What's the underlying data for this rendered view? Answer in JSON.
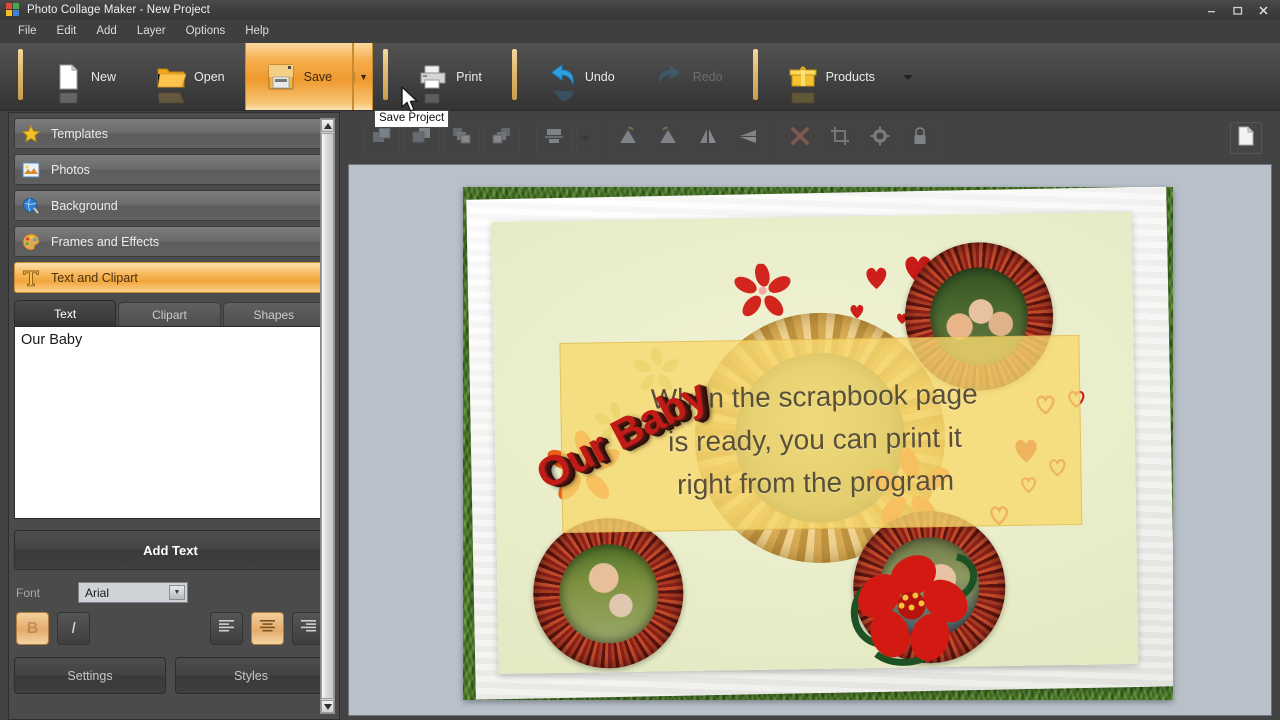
{
  "window": {
    "title": "Photo Collage Maker - New Project",
    "logo_icon": "app-logo-icon",
    "minimize_label": "–",
    "maximize_label": "❐",
    "close_label": "✕"
  },
  "menubar": {
    "items": [
      {
        "label": "File"
      },
      {
        "label": "Edit"
      },
      {
        "label": "Add"
      },
      {
        "label": "Layer"
      },
      {
        "label": "Options"
      },
      {
        "label": "Help"
      }
    ]
  },
  "toolbar": {
    "buttons": [
      {
        "label": "New",
        "icon": "new-document-icon",
        "state": "normal"
      },
      {
        "label": "Open",
        "icon": "open-folder-icon",
        "state": "normal"
      },
      {
        "label": "Save",
        "icon": "floppy-disk-icon",
        "state": "active"
      },
      {
        "label": "Print",
        "icon": "printer-icon",
        "state": "normal"
      },
      {
        "label": "Undo",
        "icon": "undo-arrow-icon",
        "state": "normal"
      },
      {
        "label": "Redo",
        "icon": "redo-arrow-icon",
        "state": "disabled"
      },
      {
        "label": "Products",
        "icon": "products-box-icon",
        "state": "normal"
      }
    ],
    "save_dropdown_icon": "chevron-down-icon",
    "products_dropdown_icon": "chevron-down-icon"
  },
  "tooltip": {
    "text": "Save Project"
  },
  "sidebar": {
    "items": [
      {
        "label": "Templates",
        "icon": "star-icon",
        "selected": false
      },
      {
        "label": "Photos",
        "icon": "photo-icon",
        "selected": false
      },
      {
        "label": "Background",
        "icon": "globe-brush-icon",
        "selected": false
      },
      {
        "label": "Frames and Effects",
        "icon": "palette-icon",
        "selected": false
      },
      {
        "label": "Text and Clipart",
        "icon": "text-t-icon",
        "selected": true
      }
    ],
    "scrollbar": {
      "up_icon": "scroll-up-arrow-icon",
      "down_icon": "scroll-down-arrow-icon"
    }
  },
  "text_panel": {
    "tabs": [
      {
        "label": "Text",
        "active": true
      },
      {
        "label": "Clipart",
        "active": false
      },
      {
        "label": "Shapes",
        "active": false
      }
    ],
    "textarea_value": "Our Baby",
    "textarea_placeholder": "",
    "add_text_label": "Add Text",
    "font_label": "Font",
    "font_value": "Arial",
    "font_options": [
      "Arial"
    ],
    "style_buttons": [
      {
        "name": "bold",
        "glyph": "B",
        "active": true
      },
      {
        "name": "italic",
        "glyph": "I",
        "active": false
      },
      {
        "name": "align-left",
        "glyph": "",
        "active": false
      },
      {
        "name": "align-center",
        "glyph": "",
        "active": true
      },
      {
        "name": "align-right",
        "glyph": "",
        "active": false
      }
    ],
    "settings_label": "Settings",
    "styles_label": "Styles"
  },
  "canvas_toolbar": {
    "buttons": [
      {
        "icon": "bring-forward-icon"
      },
      {
        "icon": "send-backward-icon"
      },
      {
        "icon": "bring-to-front-icon"
      },
      {
        "icon": "send-to-back-icon"
      },
      {
        "icon": "align-icon"
      },
      {
        "icon": "align-dropdown-icon"
      },
      {
        "icon": "rotate-left-icon"
      },
      {
        "icon": "rotate-right-icon"
      },
      {
        "icon": "flip-horizontal-icon"
      },
      {
        "icon": "flip-vertical-icon"
      },
      {
        "icon": "delete-icon"
      },
      {
        "icon": "crop-icon"
      },
      {
        "icon": "settings-gear-icon"
      },
      {
        "icon": "lock-icon"
      }
    ],
    "page_button_icon": "page-icon"
  },
  "collage": {
    "title_text": "Our Baby",
    "overlay_lines": [
      "When the scrapbook page",
      "is ready, you can print it",
      "right from the program"
    ],
    "photo_frames": [
      {
        "name": "family-photo-top-right"
      },
      {
        "name": "man-with-baby-photo-bottom-left"
      },
      {
        "name": "two-children-photo-bottom-right"
      }
    ],
    "decorations": [
      {
        "name": "red-flower-clipart"
      },
      {
        "name": "red-hearts-clipart"
      },
      {
        "name": "orange-flowers-clipart"
      },
      {
        "name": "red-hibiscus-clipart"
      },
      {
        "name": "straw-basket-clipart"
      }
    ]
  },
  "colors": {
    "accent": "#f0a337",
    "title_red": "#c21a16",
    "panel_bg": "#4b4b4b",
    "canvas_bg": "#b8c0ca"
  }
}
